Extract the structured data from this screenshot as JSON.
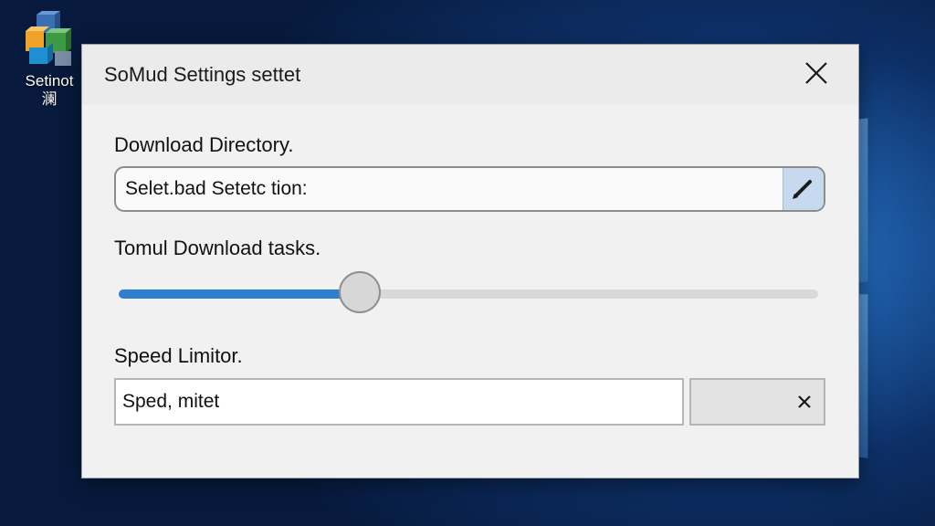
{
  "desktop": {
    "icon_label_line1": "Setinot",
    "icon_label_line2": "澜"
  },
  "dialog": {
    "title": "SoMud Settings settet",
    "close_icon": "close-icon",
    "download_directory": {
      "label": "Download Directory.",
      "value": "Selet.bad Setetc tion:",
      "edit_icon": "pencil-icon"
    },
    "download_tasks": {
      "label": "Tomul Download tasks.",
      "slider_fraction": 0.345
    },
    "speed_limitor": {
      "label": "Speed Limitor.",
      "value": "Sped, mitet",
      "clear_icon": "clear-x-icon"
    }
  },
  "colors": {
    "accent": "#2f7fd1",
    "dialog_bg": "#f1f1f1",
    "edit_button_bg": "#c7d9ef"
  }
}
